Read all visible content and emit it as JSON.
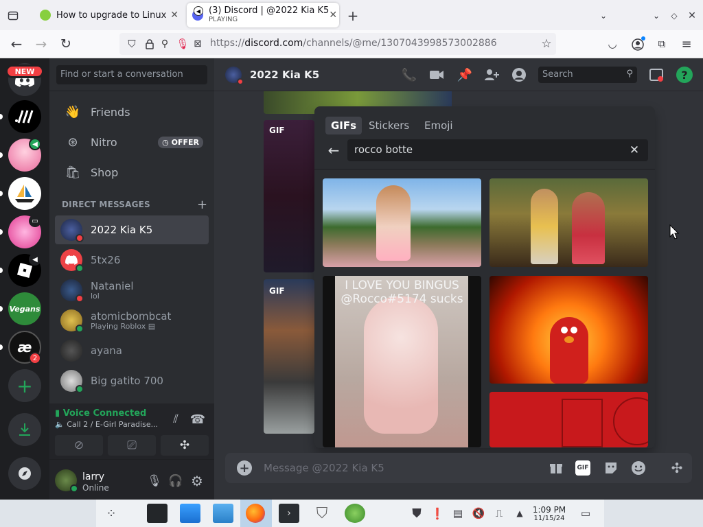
{
  "browser": {
    "tabs": [
      {
        "title": "How to upgrade to Linux M",
        "active": false
      },
      {
        "title": "(3) Discord | @2022 Kia K5",
        "subtitle": "PLAYING",
        "active": true
      }
    ],
    "url": {
      "prefix": "https://",
      "domain": "discord.com",
      "path": "/channels/@me/1307043998573002886"
    }
  },
  "guilds": {
    "new_badge": "NEW",
    "items": [
      {
        "name": "server-slashes",
        "color": "#000000"
      },
      {
        "name": "server-anime-avatar",
        "color": "#f7a8c8",
        "badge": "volume"
      },
      {
        "name": "server-sailboat",
        "color": "#ffffff"
      },
      {
        "name": "server-pink",
        "color": "#f06bb0",
        "badge": "screen"
      },
      {
        "name": "server-roblox",
        "color": "#000000",
        "badge": "volume"
      },
      {
        "name": "server-vegans",
        "color": "#2e8b3a"
      },
      {
        "name": "server-ae",
        "color": "#111111",
        "mention_count": "2"
      }
    ]
  },
  "dm_sidebar": {
    "search_placeholder": "Find or start a conversation",
    "nav": [
      {
        "label": "Friends"
      },
      {
        "label": "Nitro",
        "badge": "OFFER"
      },
      {
        "label": "Shop"
      }
    ],
    "section_title": "DIRECT MESSAGES",
    "dms": [
      {
        "name": "2022 Kia K5",
        "status": "dnd",
        "active": true
      },
      {
        "name": "5tx26",
        "status": "online"
      },
      {
        "name": "Nataniel",
        "sub": "lol",
        "status": "dnd"
      },
      {
        "name": "atomicbombcat",
        "sub": "Playing Roblox",
        "status": "online"
      },
      {
        "name": "ayana",
        "status": "offline"
      },
      {
        "name": "Big gatito 700",
        "status": "online"
      }
    ],
    "voice": {
      "status": "Voice Connected",
      "channel": "Call 2 / E-Girl Paradise..."
    },
    "user": {
      "name": "larry",
      "status": "Online"
    }
  },
  "chat": {
    "header_title": "2022 Kia K5",
    "search_placeholder": "Search",
    "gif_label": "GIF",
    "composer_placeholder": "Message @2022 Kia K5"
  },
  "gif_picker": {
    "tabs": [
      "GIFs",
      "Stickers",
      "Emoji"
    ],
    "active_tab": "GIFs",
    "query": "rocco botte",
    "cat_caption_line1": "I LOVE YOU BINGUS",
    "cat_caption_line2": "@Rocco#5174 sucks"
  },
  "taskbar": {
    "time": "1:09 PM",
    "date": "11/15/24"
  },
  "colors": {
    "blurple": "#5865f2",
    "online": "#23a55a",
    "dnd": "#f23f43",
    "bg": "#313338"
  }
}
